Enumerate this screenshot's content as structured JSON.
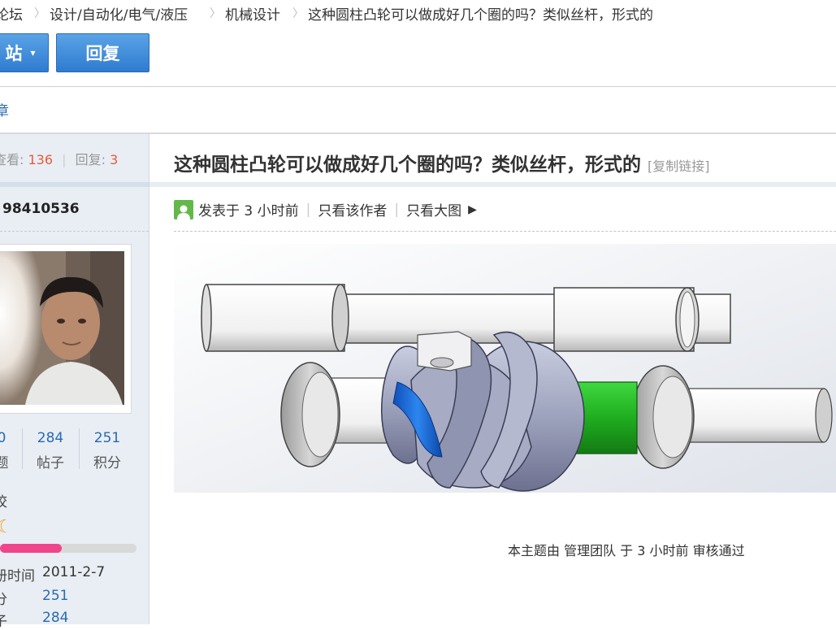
{
  "breadcrumb": {
    "items": [
      "论坛",
      "设计/自动化/电气/液压",
      "机械设计",
      "这种圆柱凸轮可以做成好几个圈的吗？类似丝杆，形式的"
    ],
    "separator": "〉"
  },
  "toolbar": {
    "post_label": "站",
    "reply_label": "回复"
  },
  "thread_nav": {
    "label": "章"
  },
  "thread_stats": {
    "views_label": "查看:",
    "views": "136",
    "replies_label": "回复:",
    "replies": "3"
  },
  "author": {
    "username": "98410536",
    "stats": [
      {
        "value": "0",
        "label": "题"
      },
      {
        "value": "284",
        "label": "帖子"
      },
      {
        "value": "251",
        "label": "积分"
      }
    ],
    "level_text": "校",
    "level_icon": "moon-icon",
    "level_progress": 0.45,
    "info": [
      {
        "key": "册时间",
        "value": "2011-2-7"
      },
      {
        "key": "分",
        "value": "251"
      },
      {
        "key": "子",
        "value": "284"
      }
    ]
  },
  "post": {
    "title": "这种圆柱凸轮可以做成好几个圈的吗？类似丝杆，形式的",
    "copy_link": "[复制链接]",
    "posted": "发表于 3 小时前",
    "only_author": "只看该作者",
    "only_large": "只看大图"
  },
  "review_note": "本主题由 管理团队 于 3 小时前 审核通过",
  "colors": {
    "accent": "#2f7bd0",
    "stat_number": "#e55b3c",
    "progress": "#f0458a",
    "cam_green": "#22b022",
    "cam_blue": "#1a6fe0"
  }
}
